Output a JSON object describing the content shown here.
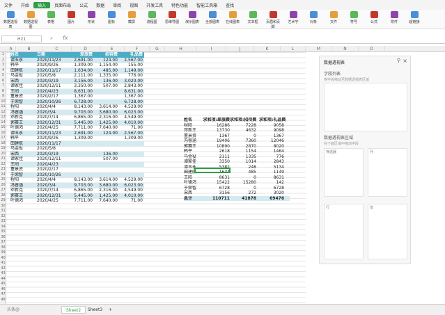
{
  "menu": [
    "文件",
    "开始",
    "插入",
    "页面布局",
    "公式",
    "数据",
    "审阅",
    "视图",
    "开发工具",
    "特色功能",
    "智能工具箱",
    "查找"
  ],
  "ribbon": [
    "数据透视表",
    "数据透视图",
    "表格",
    "图片",
    "形状",
    "图标",
    "截屏",
    "流程图",
    "思维导图",
    "演示图表",
    "全部图表",
    "在线图表",
    "文本框",
    "页眉和页脚",
    "艺术字",
    "对象",
    "文件",
    "符号",
    "公式",
    "附件",
    "超链接"
  ],
  "namebox": "H21",
  "columns": [
    "A",
    "B",
    "C",
    "D",
    "E",
    "F",
    "G",
    "H",
    "I",
    "J",
    "K",
    "L",
    "M",
    "N",
    "O"
  ],
  "table": {
    "headers": [
      "姓名",
      "日期",
      "差旅费",
      "招待费",
      "礼品费"
    ],
    "rows": [
      [
        "谭玉永",
        "2020/11/23",
        "2,691.00",
        "124.00",
        "2,567.00"
      ],
      [
        "韩平",
        "2020/9/26",
        "1,309.00",
        "1,154.00",
        "155.00"
      ],
      [
        "田建航",
        "2020/11/17",
        "1,634.00",
        "485.00",
        "1,149.00"
      ],
      [
        "马金役",
        "2020/5/8",
        "2,111.00",
        "1,335.00",
        "776.00"
      ],
      [
        "宋西",
        "2020/3/19",
        "3,156.00",
        "136.00",
        "3,020.00"
      ],
      [
        "谭家佳",
        "2020/12/11",
        "3,350.00",
        "507.00",
        "2,843.00"
      ],
      [
        "王阳",
        "2020/4/23",
        "8,631.00",
        "",
        "8,631.00"
      ],
      [
        "董景资",
        "2020/2/17",
        "1,367.00",
        "",
        "1,367.00"
      ],
      [
        "于荣智",
        "2020/10/26",
        "6,728.00",
        "",
        "6,728.00"
      ],
      [
        "程阳",
        "2020/4/4",
        "8,143.00",
        "3,614.00",
        "4,529.00"
      ],
      [
        "冯睿涵",
        "2020/3/4",
        "9,703.00",
        "3,680.00",
        "6,023.00"
      ],
      [
        "邓新克",
        "2020/7/14",
        "6,865.00",
        "2,316.00",
        "4,549.00"
      ],
      [
        "郭赛王",
        "2020/12/31",
        "5,445.00",
        "1,425.00",
        "4,010.00"
      ],
      [
        "叶德鸿",
        "2020/4/25",
        "7,711.00",
        "7,640.00",
        "71.00"
      ],
      [
        "谭玉永",
        "2020/11/23",
        "2,691.00",
        "124.00",
        "2,567.00"
      ],
      [
        "韩平",
        "2020/9/26",
        "1,309.00",
        "",
        "1,309.00"
      ],
      [
        "田建航",
        "2020/11/17",
        "",
        "",
        ""
      ],
      [
        "马金役",
        "2020/5/8",
        "",
        "",
        ""
      ],
      [
        "宋西",
        "2020/3/19",
        "",
        "136.00",
        ""
      ],
      [
        "谭家佳",
        "2020/12/11",
        "",
        "507.00",
        ""
      ],
      [
        "王阳",
        "2020/4/23",
        "",
        "",
        ""
      ],
      [
        "董景资",
        "2020/2/17",
        "",
        "",
        ""
      ],
      [
        "于荣智",
        "2020/10/26",
        "",
        "",
        ""
      ],
      [
        "程阳",
        "2020/4/4",
        "8,143.00",
        "3,614.00",
        "4,529.00"
      ],
      [
        "冯睿涵",
        "2020/3/4",
        "9,703.00",
        "3,680.00",
        "6,023.00"
      ],
      [
        "邓新克",
        "2020/7/14",
        "6,865.00",
        "2,316.00",
        "4,549.00"
      ],
      [
        "郭赛王",
        "2020/12/31",
        "5,445.00",
        "1,425.00",
        "4,010.00"
      ],
      [
        "叶德鸿",
        "2020/4/25",
        "7,711.00",
        "7,640.00",
        "71.00"
      ]
    ]
  },
  "pivot": {
    "headers": [
      "姓名",
      "求和项:差旅费",
      "求和项:招待费",
      "求和项:礼品费"
    ],
    "rows": [
      [
        "程阳",
        "16286",
        "7228",
        "9058"
      ],
      [
        "邓新王",
        "13730",
        "4632",
        "9098"
      ],
      [
        "董景资",
        "1367",
        "0",
        "1367"
      ],
      [
        "冯睿涵",
        "19406",
        "7360",
        "12046"
      ],
      [
        "郭赛王",
        "10890",
        "2870",
        "8020"
      ],
      [
        "韩平",
        "2618",
        "1154",
        "1464"
      ],
      [
        "马金役",
        "2111",
        "1335",
        "776"
      ],
      [
        "谭家佳",
        "3350",
        "1014",
        "2843"
      ],
      [
        "谭玉永",
        "5382",
        "248",
        "5134"
      ],
      [
        "田建航",
        "1634",
        "485",
        "1149"
      ],
      [
        "王阳",
        "8631",
        "0",
        "8631"
      ],
      [
        "叶德鸿",
        "15422",
        "15280",
        "142"
      ],
      [
        "于荣智",
        "6728",
        "0",
        "6728"
      ],
      [
        "宋西",
        "3156",
        "272",
        "3020"
      ]
    ],
    "total": [
      "总计",
      "110711",
      "41878",
      "69476"
    ]
  },
  "pane": {
    "title": "数据透视表",
    "field_list": "字段列表",
    "field_hint": "将字段拖动至数据透视表区域",
    "area_title": "数据透视表区域",
    "area_hint": "在下面区域中拖动字段",
    "filter": "筛选器",
    "columns": "列",
    "rows": "行",
    "values": "值"
  },
  "tabs": [
    "Sheet2",
    "Sheet3"
  ],
  "watermark": "头条@"
}
